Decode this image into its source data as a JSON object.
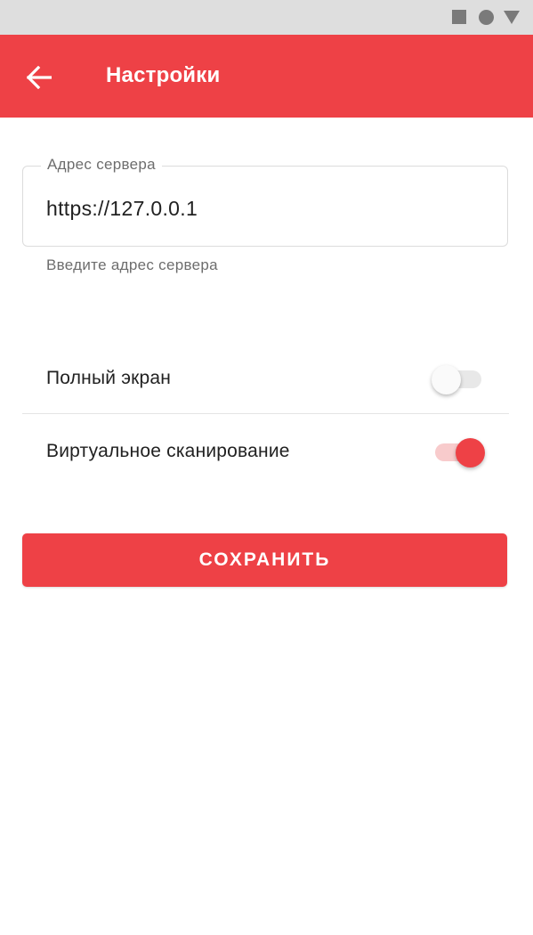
{
  "statusbar": {
    "icons": [
      "square-icon",
      "circle-icon",
      "triangle-icon"
    ]
  },
  "appbar": {
    "title": "Настройки",
    "back_icon": "arrow-back-icon"
  },
  "server_field": {
    "label": "Адрес сервера",
    "value": "https://127.0.0.1",
    "helper": "Введите адрес сервера"
  },
  "settings": [
    {
      "label": "Полный экран",
      "enabled": false
    },
    {
      "label": "Виртуальное сканирование",
      "enabled": true
    }
  ],
  "save_button": {
    "label": "СОХРАНИТЬ"
  },
  "colors": {
    "accent": "#ee4146",
    "statusbar": "#dedede",
    "switch_on_track": "#f8cbcc",
    "switch_off_track": "#e8e8e8"
  }
}
